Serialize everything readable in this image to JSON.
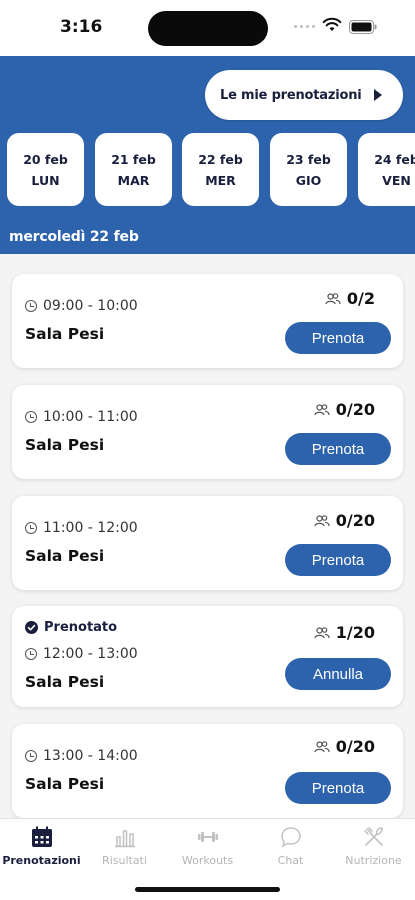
{
  "status_bar": {
    "time": "3:16"
  },
  "header": {
    "my_bookings_label": "Le mie prenotazioni",
    "selected_date": "mercoledì 22 feb"
  },
  "days": [
    {
      "date": "20 feb",
      "day": "LUN"
    },
    {
      "date": "21 feb",
      "day": "MAR"
    },
    {
      "date": "22 feb",
      "day": "MER"
    },
    {
      "date": "23 feb",
      "day": "GIO"
    },
    {
      "date": "24 feb",
      "day": "VEN"
    }
  ],
  "slots": [
    {
      "time": "09:00 - 10:00",
      "room": "Sala Pesi",
      "capacity": "0/2",
      "button": "Prenota",
      "status": ""
    },
    {
      "time": "10:00 - 11:00",
      "room": "Sala Pesi",
      "capacity": "0/20",
      "button": "Prenota",
      "status": ""
    },
    {
      "time": "11:00 - 12:00",
      "room": "Sala Pesi",
      "capacity": "0/20",
      "button": "Prenota",
      "status": ""
    },
    {
      "time": "12:00 - 13:00",
      "room": "Sala Pesi",
      "capacity": "1/20",
      "button": "Annulla",
      "status": "Prenotato"
    },
    {
      "time": "13:00 - 14:00",
      "room": "Sala Pesi",
      "capacity": "0/20",
      "button": "Prenota",
      "status": ""
    }
  ],
  "tabs": [
    {
      "label": "Prenotazioni",
      "icon": "calendar-icon",
      "active": true
    },
    {
      "label": "Risultati",
      "icon": "bar-chart-icon",
      "active": false
    },
    {
      "label": "Workouts",
      "icon": "dumbbell-icon",
      "active": false
    },
    {
      "label": "Chat",
      "icon": "chat-bubble-icon",
      "active": false
    },
    {
      "label": "Nutrizione",
      "icon": "cutlery-icon",
      "active": false
    }
  ],
  "colors": {
    "primary": "#2d63ad",
    "dark_text": "#1a1f3d",
    "inactive_tab": "#b5b5b5"
  }
}
